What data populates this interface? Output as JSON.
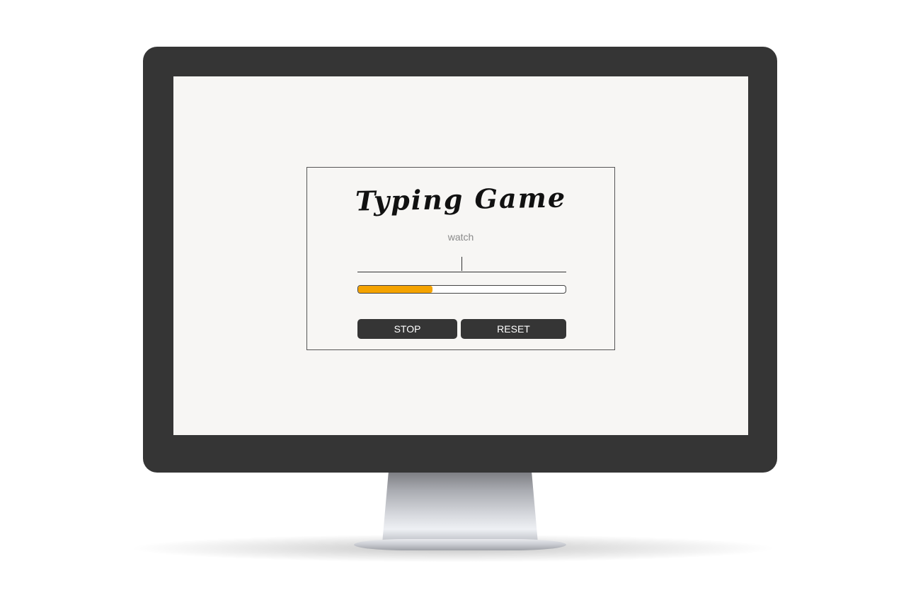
{
  "game": {
    "title": "Typing Game",
    "target_word": "watch",
    "input_value": "",
    "progress_percent": 36,
    "progress_color": "#f5a300"
  },
  "buttons": {
    "stop_label": "STOP",
    "reset_label": "RESET"
  },
  "colors": {
    "bezel": "#353535",
    "screen": "#f7f6f4",
    "button": "#353535"
  }
}
